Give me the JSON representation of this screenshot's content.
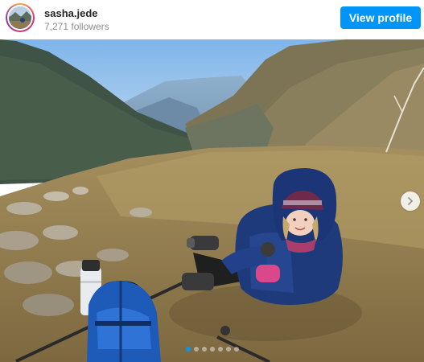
{
  "header": {
    "username": "sasha.jede",
    "followers": "7,271 followers",
    "view_profile_label": "View profile",
    "avatar_icon": "profile-avatar"
  },
  "post": {
    "next_icon": "chevron-right-icon",
    "carousel": {
      "slide_count": 7,
      "active_index": 0
    }
  },
  "colors": {
    "accent": "#0095f6",
    "username": "#262626",
    "secondary_text": "#8e8e8e"
  }
}
